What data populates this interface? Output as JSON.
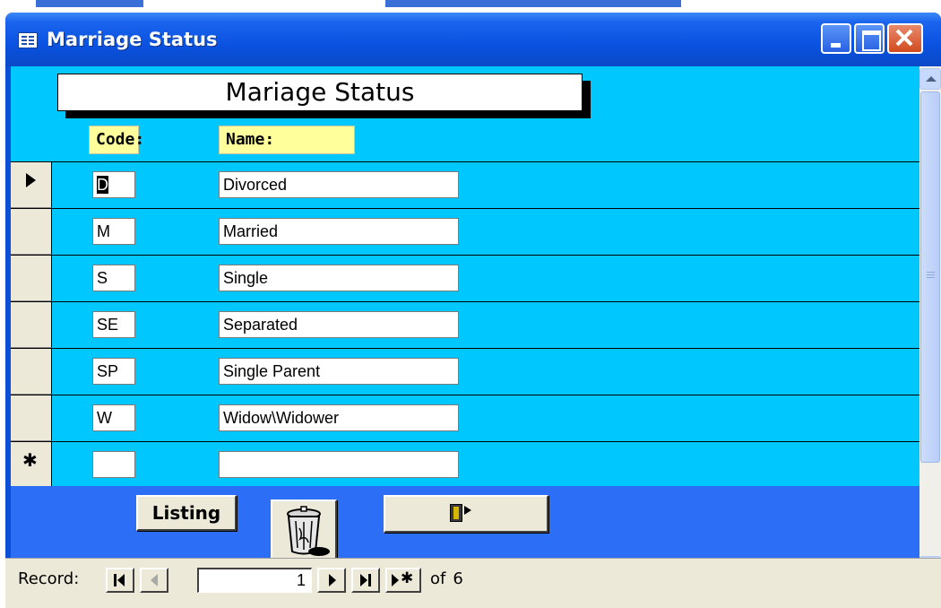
{
  "window": {
    "title": "Marriage Status"
  },
  "form": {
    "header": "Mariage Status",
    "columns": {
      "code": "Code:",
      "name": "Name:"
    },
    "rows": [
      {
        "code": "D",
        "name": "Divorced"
      },
      {
        "code": "M",
        "name": "Married"
      },
      {
        "code": "S",
        "name": "Single"
      },
      {
        "code": "SE",
        "name": "Separated"
      },
      {
        "code": "SP",
        "name": "Single Parent"
      },
      {
        "code": "W",
        "name": "Widow\\Widower"
      },
      {
        "code": "",
        "name": ""
      }
    ]
  },
  "footer": {
    "listing_label": "Listing",
    "trash_icon": "trash-can-icon",
    "exit_icon": "exit-door-icon"
  },
  "record_nav": {
    "label": "Record:",
    "current": "1",
    "of_label": "of",
    "total": "6"
  },
  "colors": {
    "form_bg": "#00c8fe",
    "footer_bg": "#2c6ef5",
    "header_label_bg": "#ffff9c",
    "titlebar": "#0a52e0"
  }
}
